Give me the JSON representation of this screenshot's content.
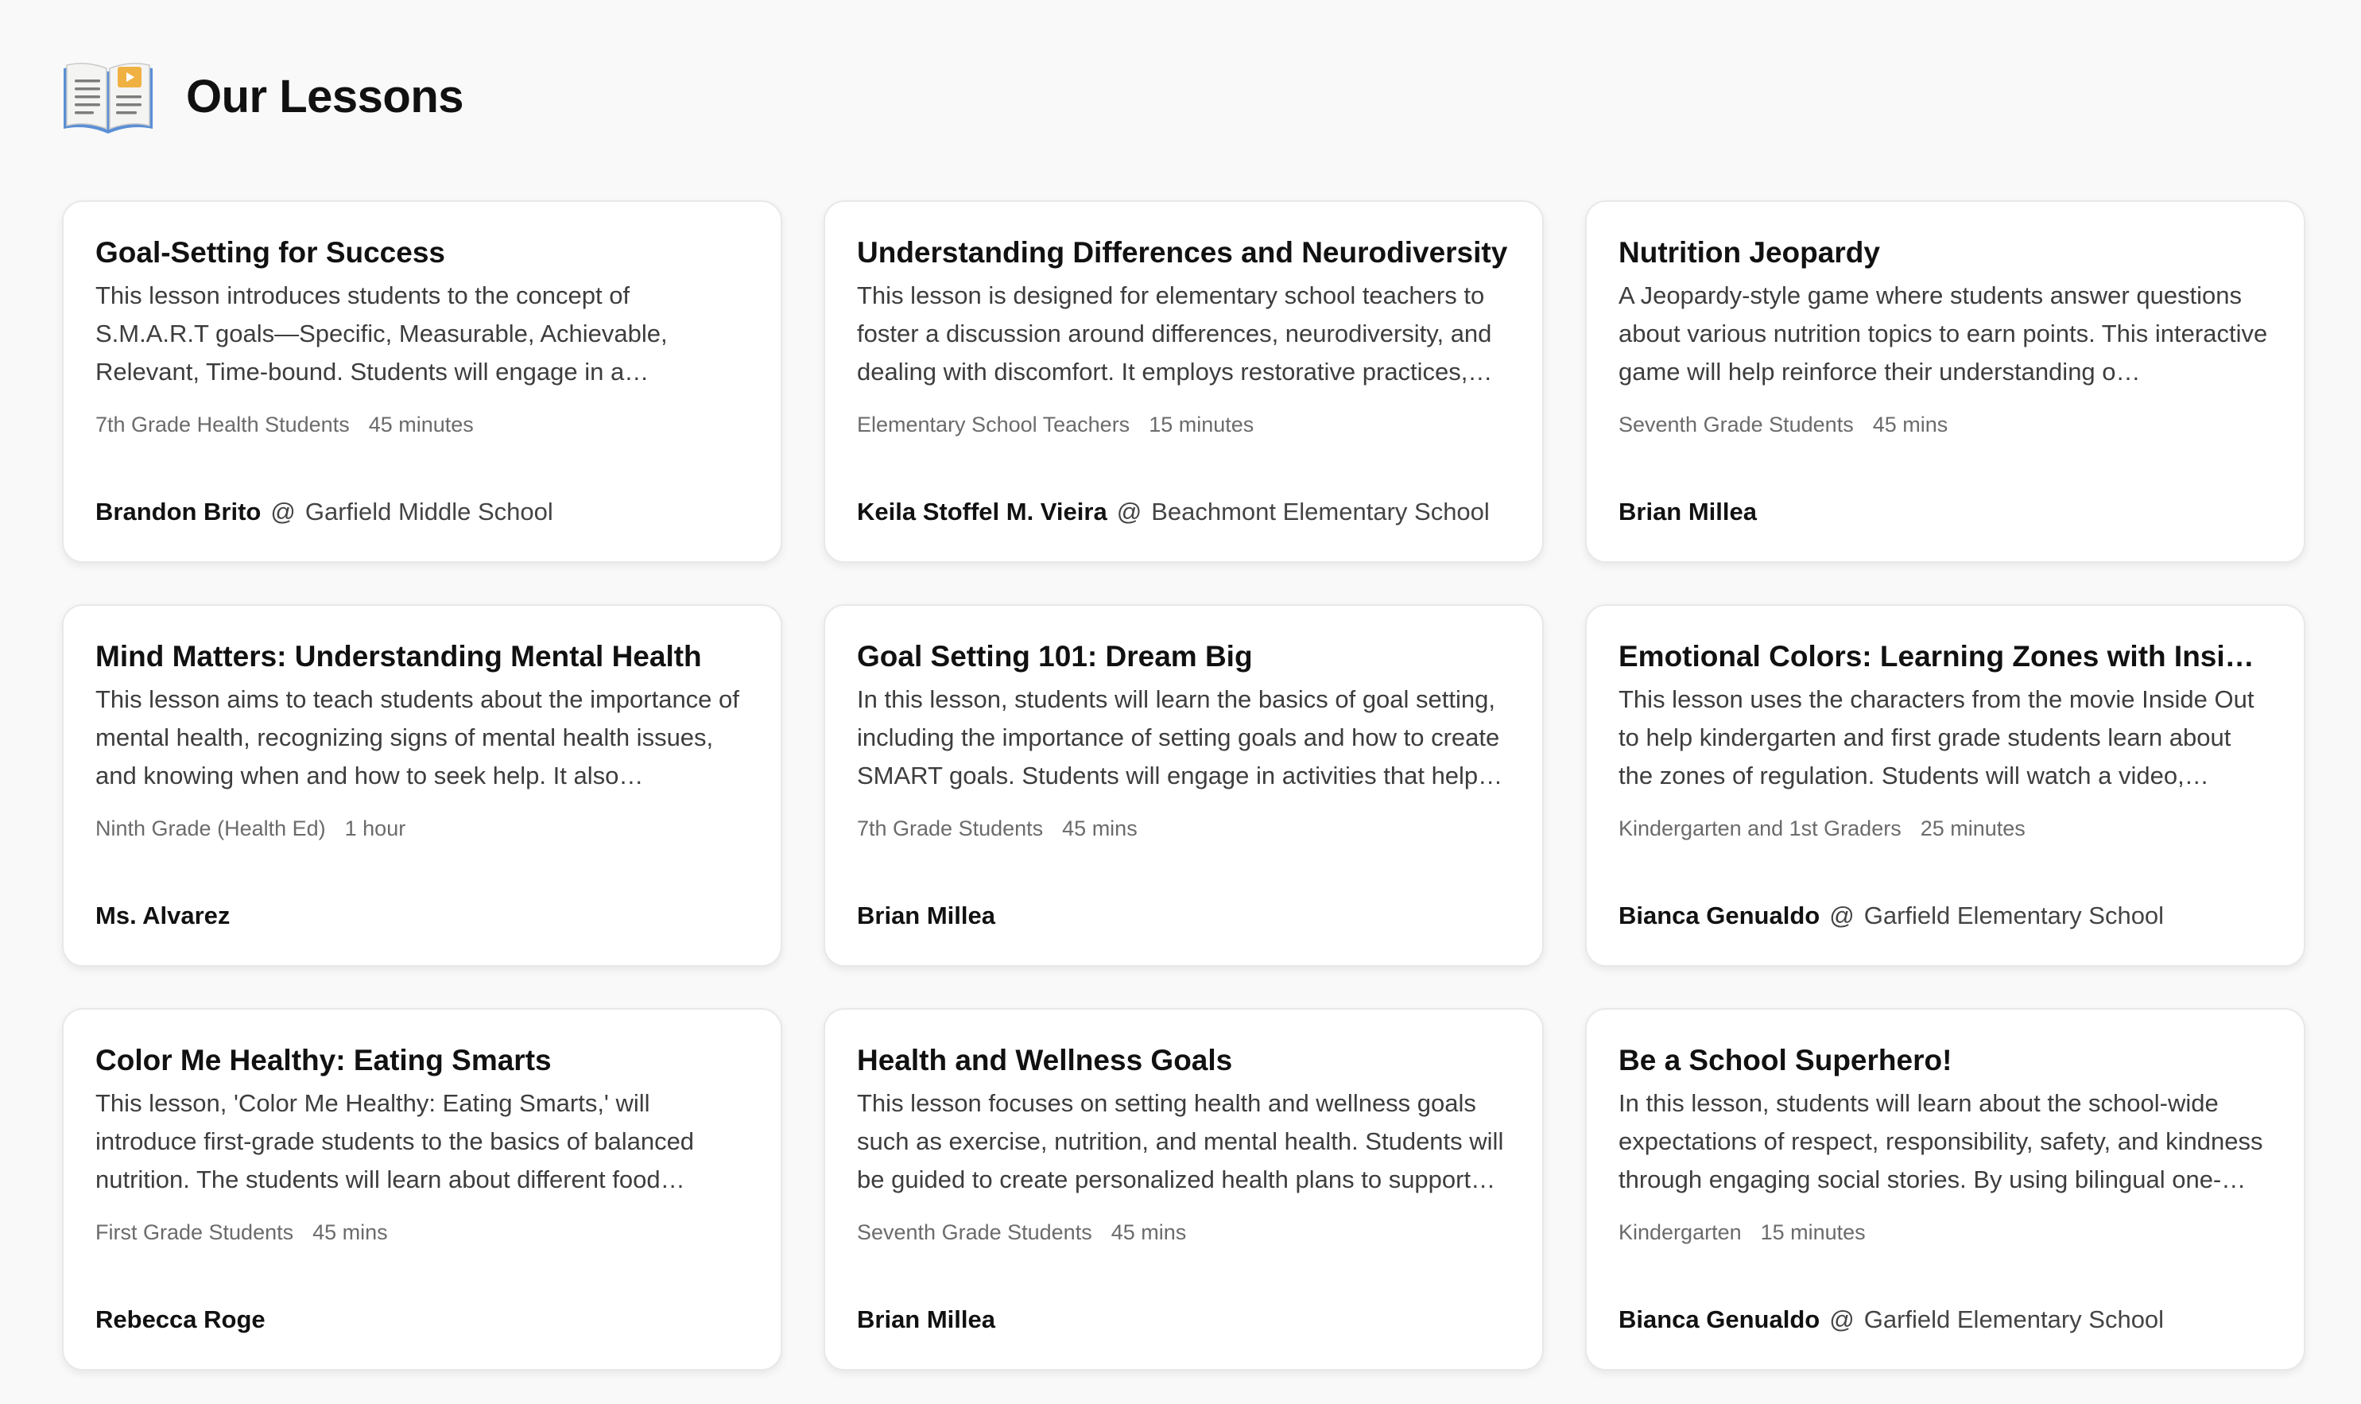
{
  "page": {
    "title": "Our Lessons",
    "icon": "open-book-icon"
  },
  "lessons": [
    {
      "title": "Goal-Setting for Success",
      "description": "This lesson introduces students to the concept of S.M.A.R.T goals—Specific, Measurable, Achievable, Relevant, Time-bound. Students will engage in a discussion, watch a…",
      "audience": "7th Grade Health Students",
      "duration": "45 minutes",
      "author": "Brandon Brito",
      "at": "@",
      "school": "Garfield Middle School"
    },
    {
      "title": "Understanding Differences and Neurodiversity",
      "description": "This lesson is designed for elementary school teachers to foster a discussion around differences, neurodiversity, and dealing with discomfort. It employs restorative practices,…",
      "audience": "Elementary School Teachers",
      "duration": "15 minutes",
      "author": "Keila Stoffel M. Vieira",
      "at": "@",
      "school": "Beachmont Elementary School"
    },
    {
      "title": "Nutrition Jeopardy",
      "description": "A Jeopardy-style game where students answer questions about various nutrition topics to earn points. This interactive game will help reinforce their understanding o…",
      "audience": "Seventh Grade Students",
      "duration": "45 mins",
      "author": "Brian Millea",
      "at": null,
      "school": null
    },
    {
      "title": "Mind Matters: Understanding Mental Health",
      "description": "This lesson aims to teach students about the importance of mental health, recognizing signs of mental health issues, and knowing when and how to seek help. It also emphasiz…",
      "audience": "Ninth Grade (Health Ed)",
      "duration": "1 hour",
      "author": "Ms. Alvarez",
      "at": null,
      "school": null
    },
    {
      "title": "Goal Setting 101: Dream Big",
      "description": "In this lesson, students will learn the basics of goal setting, including the importance of setting goals and how to create SMART goals. Students will engage in activities that help…",
      "audience": "7th Grade Students",
      "duration": "45 mins",
      "author": "Brian Millea",
      "at": null,
      "school": null
    },
    {
      "title": "Emotional Colors: Learning Zones with Inside Out",
      "description": "This lesson uses the characters from the movie Inside Out to help kindergarten and first grade students learn about the zones of regulation. Students will watch a video, discu…",
      "audience": "Kindergarten and 1st Graders",
      "duration": "25 minutes",
      "author": "Bianca Genualdo",
      "at": "@",
      "school": "Garfield Elementary School"
    },
    {
      "title": "Color Me Healthy: Eating Smarts",
      "description": "This lesson, 'Color Me Healthy: Eating Smarts,' will introduce first-grade students to the basics of balanced nutrition. The students will learn about different food…",
      "audience": "First Grade Students",
      "duration": "45 mins",
      "author": "Rebecca Roge",
      "at": null,
      "school": null
    },
    {
      "title": "Health and Wellness Goals",
      "description": "This lesson focuses on setting health and wellness goals such as exercise, nutrition, and mental health. Students will be guided to create personalized health plans to support…",
      "audience": "Seventh Grade Students",
      "duration": "45 mins",
      "author": "Brian Millea",
      "at": null,
      "school": null
    },
    {
      "title": "Be a School Superhero!",
      "description": "In this lesson, students will learn about the school-wide expectations of respect, responsibility, safety, and kindness through engaging social stories. By using bilingual one-pa…",
      "audience": "Kindergarten",
      "duration": "15 minutes",
      "author": "Bianca Genualdo",
      "at": "@",
      "school": "Garfield Elementary School"
    }
  ]
}
